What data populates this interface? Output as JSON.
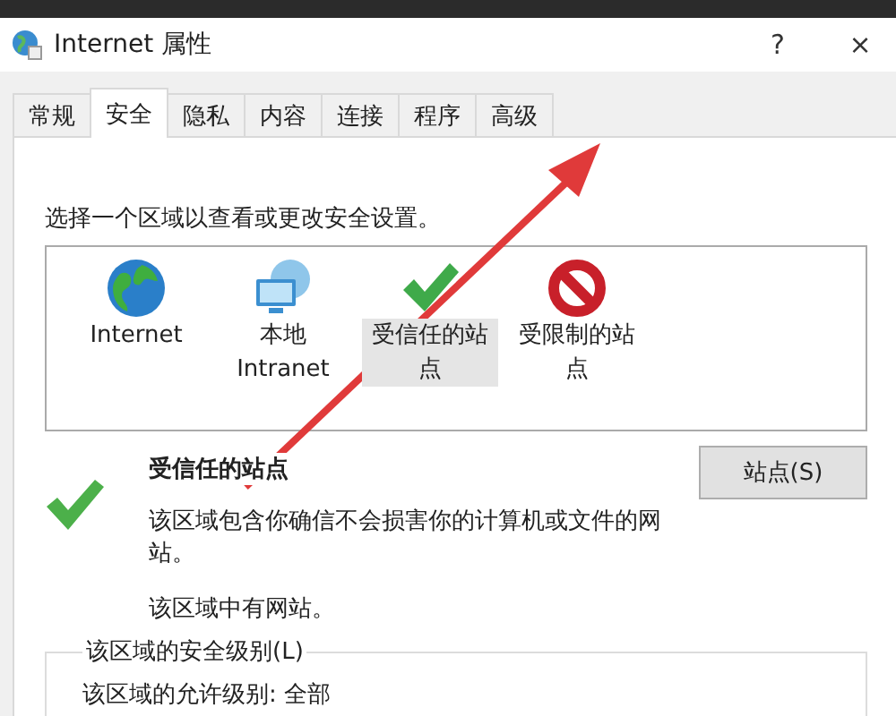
{
  "window": {
    "title": "Internet 属性",
    "help": "?",
    "close": "×"
  },
  "tabs": [
    {
      "label": "常规",
      "selected": false
    },
    {
      "label": "安全",
      "selected": true
    },
    {
      "label": "隐私",
      "selected": false
    },
    {
      "label": "内容",
      "selected": false
    },
    {
      "label": "连接",
      "selected": false
    },
    {
      "label": "程序",
      "selected": false
    },
    {
      "label": "高级",
      "selected": false
    }
  ],
  "instruction": "选择一个区域以查看或更改安全设置。",
  "zones": [
    {
      "kind": "globe",
      "label": "Internet",
      "selected": false
    },
    {
      "kind": "network",
      "label": "本地 Intranet",
      "selected": false
    },
    {
      "kind": "check",
      "label": "受信任的站点",
      "selected": true
    },
    {
      "kind": "blocked",
      "label": "受限制的站点",
      "selected": false
    }
  ],
  "zone_detail": {
    "title": "受信任的站点",
    "description": "该区域包含你确信不会损害你的计算机或文件的网站。",
    "note": "该区域中有网站。",
    "sites_button": "站点(S)"
  },
  "security_level": {
    "legend": "该区域的安全级别(L)",
    "allowed": "该区域的允许级别: 全部"
  }
}
